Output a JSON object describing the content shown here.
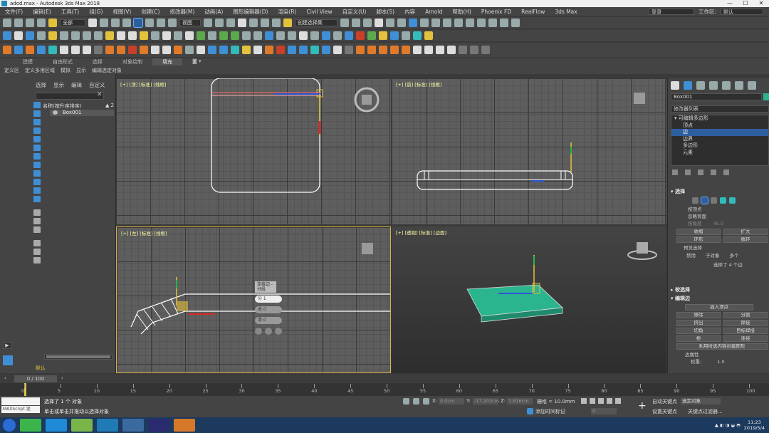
{
  "titlebar": {
    "title": "adod.max - Autodesk 3ds Max 2018"
  },
  "menu": [
    "文件(F)",
    "编辑(E)",
    "工具(T)",
    "组(G)",
    "视图(V)",
    "创建(C)",
    "修改器(M)",
    "动画(A)",
    "图形编辑器(D)",
    "渲染(R)",
    "Civil View",
    "自定义(U)",
    "脚本(S)",
    "内容",
    "Arnold",
    "帮助(H)",
    "Phoenix FD",
    "RealFlow",
    "3ds Max"
  ],
  "menu_right": {
    "login": "登录",
    "workspace_label": "工作区:",
    "workspace_value": "默认"
  },
  "toolbar": {
    "filter": "全部",
    "view_dropdown": "视图",
    "selset": "创建选择集"
  },
  "ribbon": {
    "tabs": [
      "建模",
      "自由形式",
      "选择",
      "对象绘制",
      "填充"
    ],
    "active_tab": 4,
    "row2": [
      "定义区",
      "定义多用区域",
      "模拟",
      "显示",
      "编辑选定对象"
    ]
  },
  "scene": {
    "tabs": [
      "选择",
      "显示",
      "编辑",
      "自定义"
    ],
    "header": "名称(按升序排序)",
    "header_count": "▲ 2",
    "items": [
      "Box001"
    ],
    "default_layer": "默认"
  },
  "viewports": {
    "top": {
      "label_a": "[+]",
      "label_b": "[顶]",
      "label_c": "[标准]",
      "label_d": "[线框]"
    },
    "front": {
      "label_a": "[+]",
      "label_b": "[前]",
      "label_c": "[标准]",
      "label_d": "[线框]"
    },
    "left": {
      "label_a": "[+]",
      "label_b": "[左]",
      "label_c": "[标准]",
      "label_d": "[线框]"
    },
    "persp": {
      "label_a": "[+]",
      "label_b": "[透视]",
      "label_c": "[标准]",
      "label_d": "[边面]"
    }
  },
  "quad": {
    "title": "连接边 -分段",
    "rows": [
      "分 1",
      "收 0",
      "滑 0"
    ]
  },
  "cmd": {
    "object_name": "Box001",
    "modifier_list": "修改器列表",
    "stack_root": "可编辑多边形",
    "stack_items": [
      "顶点",
      "边",
      "边界",
      "多边形",
      "元素"
    ],
    "stack_selected": 1,
    "sel_title": "选择",
    "sel_checks": [
      "按顶点",
      "忽略背面"
    ],
    "sel_angle": "按角度",
    "sel_angle_val": "45.0",
    "btn_shrink": "收缩",
    "btn_grow": "扩大",
    "btn_ring": "环形",
    "btn_loop": "循环",
    "preview": "预览选择",
    "preview_opts": [
      "禁用",
      "子对象",
      "多个"
    ],
    "sel_status": "选择了 4 个边",
    "soft_title": "软选择",
    "edit_title": "编辑边",
    "insert_vertex": "插入顶点",
    "btn_remove": "移除",
    "btn_split": "分割",
    "btn_extrude": "挤出",
    "btn_weld": "焊接",
    "btn_chamfer": "切角",
    "btn_target_weld": "目标焊接",
    "btn_bridge": "桥",
    "btn_connect": "连接",
    "create_shape": "利用所选内容创建图形",
    "edge_props": "边属性",
    "weight_label": "权重:",
    "weight_val": "1.0"
  },
  "timeline": {
    "frame": "0 / 100",
    "ticks": [
      "0",
      "5",
      "10",
      "15",
      "20",
      "25",
      "30",
      "35",
      "40",
      "45",
      "50",
      "55",
      "60",
      "65",
      "70",
      "75",
      "80",
      "85",
      "90",
      "95",
      "100"
    ]
  },
  "status": {
    "maxscript": "MAXScript 迷",
    "line1": "选择了 1 个 对象",
    "line2": "单击或单击并拖动以选择对象",
    "x_label": "X:",
    "x_val": "0.0cm",
    "y_label": "Y:",
    "y_val": "-17.203cm",
    "z_label": "Z:",
    "z_val": "1.816cm",
    "grid": "栅格 = 10.0mm",
    "add_time_tag": "添加时间标记",
    "auto_key": "自动关键点",
    "set_key": "设置关键点",
    "selected_obj": "选定对象",
    "key_filters": "关键点过滤器...",
    "frame_val": "0"
  },
  "taskbar": {
    "time": "11:23",
    "date": "2019/5/4"
  },
  "colors": {
    "accent": "#3f8fd6",
    "selection": "#2d5f9e",
    "active_border": "#d6b24a",
    "object_green": "#2bb58f"
  }
}
